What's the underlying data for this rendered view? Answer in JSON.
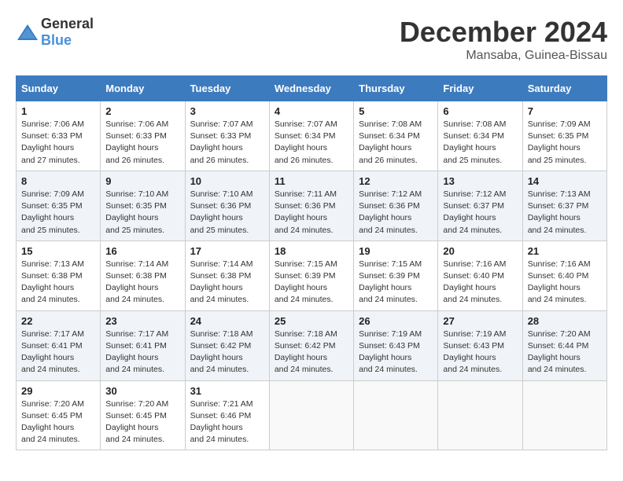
{
  "header": {
    "logo_general": "General",
    "logo_blue": "Blue",
    "month_title": "December 2024",
    "location": "Mansaba, Guinea-Bissau"
  },
  "weekdays": [
    "Sunday",
    "Monday",
    "Tuesday",
    "Wednesday",
    "Thursday",
    "Friday",
    "Saturday"
  ],
  "weeks": [
    [
      {
        "day": "1",
        "sunrise": "7:06 AM",
        "sunset": "6:33 PM",
        "daylight": "11 hours and 27 minutes."
      },
      {
        "day": "2",
        "sunrise": "7:06 AM",
        "sunset": "6:33 PM",
        "daylight": "11 hours and 26 minutes."
      },
      {
        "day": "3",
        "sunrise": "7:07 AM",
        "sunset": "6:33 PM",
        "daylight": "11 hours and 26 minutes."
      },
      {
        "day": "4",
        "sunrise": "7:07 AM",
        "sunset": "6:34 PM",
        "daylight": "11 hours and 26 minutes."
      },
      {
        "day": "5",
        "sunrise": "7:08 AM",
        "sunset": "6:34 PM",
        "daylight": "11 hours and 26 minutes."
      },
      {
        "day": "6",
        "sunrise": "7:08 AM",
        "sunset": "6:34 PM",
        "daylight": "11 hours and 25 minutes."
      },
      {
        "day": "7",
        "sunrise": "7:09 AM",
        "sunset": "6:35 PM",
        "daylight": "11 hours and 25 minutes."
      }
    ],
    [
      {
        "day": "8",
        "sunrise": "7:09 AM",
        "sunset": "6:35 PM",
        "daylight": "11 hours and 25 minutes."
      },
      {
        "day": "9",
        "sunrise": "7:10 AM",
        "sunset": "6:35 PM",
        "daylight": "11 hours and 25 minutes."
      },
      {
        "day": "10",
        "sunrise": "7:10 AM",
        "sunset": "6:36 PM",
        "daylight": "11 hours and 25 minutes."
      },
      {
        "day": "11",
        "sunrise": "7:11 AM",
        "sunset": "6:36 PM",
        "daylight": "11 hours and 24 minutes."
      },
      {
        "day": "12",
        "sunrise": "7:12 AM",
        "sunset": "6:36 PM",
        "daylight": "11 hours and 24 minutes."
      },
      {
        "day": "13",
        "sunrise": "7:12 AM",
        "sunset": "6:37 PM",
        "daylight": "11 hours and 24 minutes."
      },
      {
        "day": "14",
        "sunrise": "7:13 AM",
        "sunset": "6:37 PM",
        "daylight": "11 hours and 24 minutes."
      }
    ],
    [
      {
        "day": "15",
        "sunrise": "7:13 AM",
        "sunset": "6:38 PM",
        "daylight": "11 hours and 24 minutes."
      },
      {
        "day": "16",
        "sunrise": "7:14 AM",
        "sunset": "6:38 PM",
        "daylight": "11 hours and 24 minutes."
      },
      {
        "day": "17",
        "sunrise": "7:14 AM",
        "sunset": "6:38 PM",
        "daylight": "11 hours and 24 minutes."
      },
      {
        "day": "18",
        "sunrise": "7:15 AM",
        "sunset": "6:39 PM",
        "daylight": "11 hours and 24 minutes."
      },
      {
        "day": "19",
        "sunrise": "7:15 AM",
        "sunset": "6:39 PM",
        "daylight": "11 hours and 24 minutes."
      },
      {
        "day": "20",
        "sunrise": "7:16 AM",
        "sunset": "6:40 PM",
        "daylight": "11 hours and 24 minutes."
      },
      {
        "day": "21",
        "sunrise": "7:16 AM",
        "sunset": "6:40 PM",
        "daylight": "11 hours and 24 minutes."
      }
    ],
    [
      {
        "day": "22",
        "sunrise": "7:17 AM",
        "sunset": "6:41 PM",
        "daylight": "11 hours and 24 minutes."
      },
      {
        "day": "23",
        "sunrise": "7:17 AM",
        "sunset": "6:41 PM",
        "daylight": "11 hours and 24 minutes."
      },
      {
        "day": "24",
        "sunrise": "7:18 AM",
        "sunset": "6:42 PM",
        "daylight": "11 hours and 24 minutes."
      },
      {
        "day": "25",
        "sunrise": "7:18 AM",
        "sunset": "6:42 PM",
        "daylight": "11 hours and 24 minutes."
      },
      {
        "day": "26",
        "sunrise": "7:19 AM",
        "sunset": "6:43 PM",
        "daylight": "11 hours and 24 minutes."
      },
      {
        "day": "27",
        "sunrise": "7:19 AM",
        "sunset": "6:43 PM",
        "daylight": "11 hours and 24 minutes."
      },
      {
        "day": "28",
        "sunrise": "7:20 AM",
        "sunset": "6:44 PM",
        "daylight": "11 hours and 24 minutes."
      }
    ],
    [
      {
        "day": "29",
        "sunrise": "7:20 AM",
        "sunset": "6:45 PM",
        "daylight": "11 hours and 24 minutes."
      },
      {
        "day": "30",
        "sunrise": "7:20 AM",
        "sunset": "6:45 PM",
        "daylight": "11 hours and 24 minutes."
      },
      {
        "day": "31",
        "sunrise": "7:21 AM",
        "sunset": "6:46 PM",
        "daylight": "11 hours and 24 minutes."
      },
      null,
      null,
      null,
      null
    ]
  ]
}
